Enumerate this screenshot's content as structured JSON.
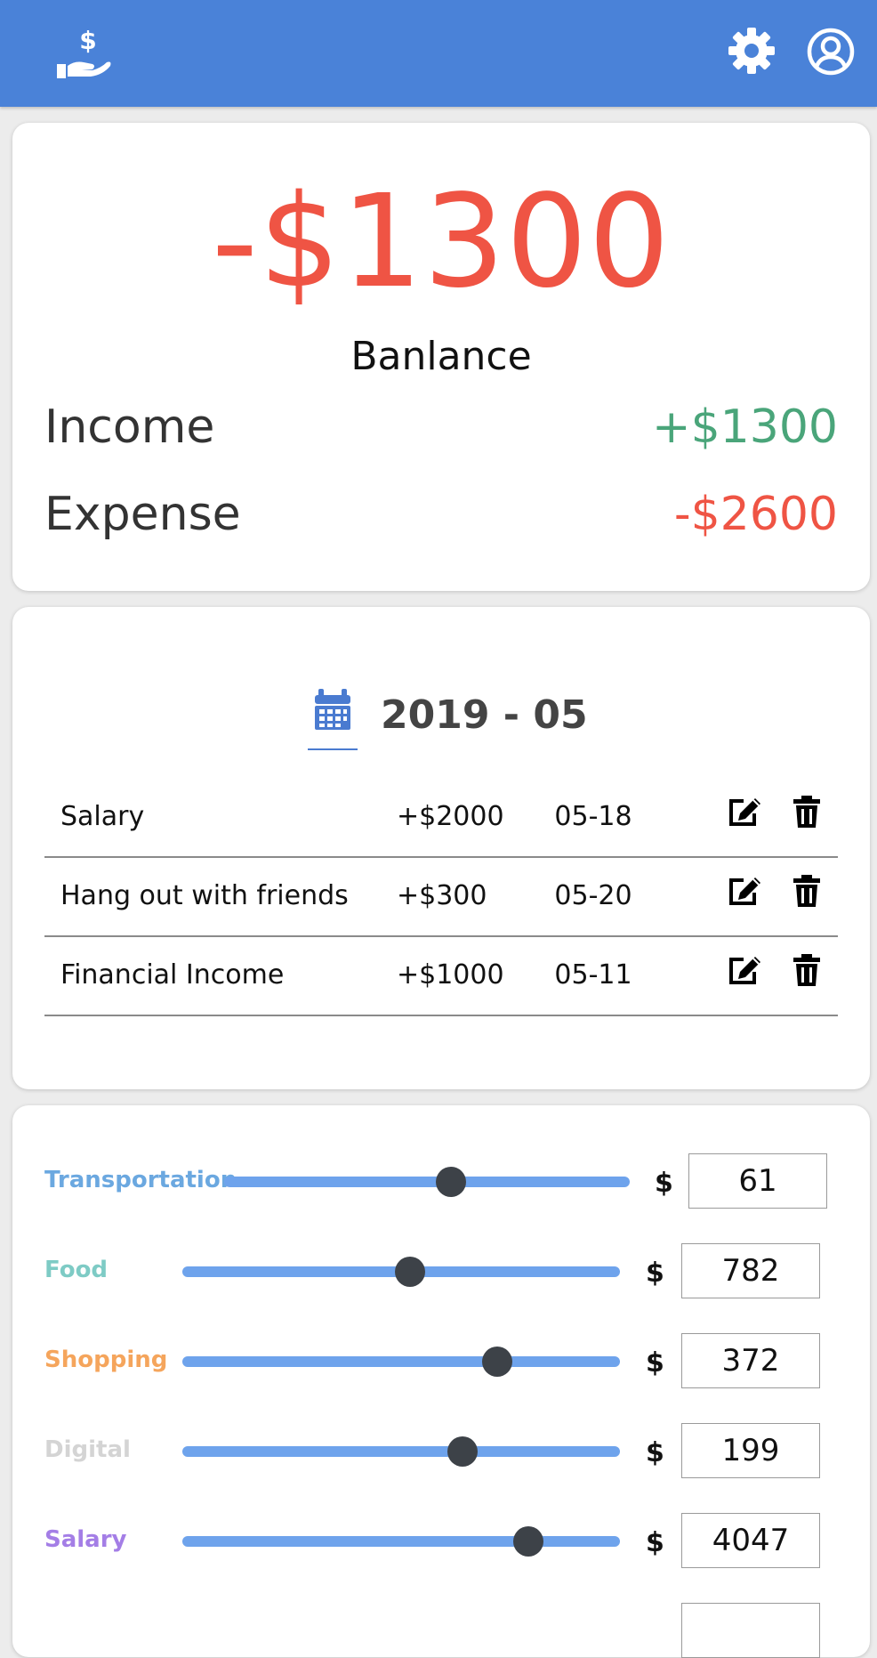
{
  "header": {
    "logo_icon": "hand-holding-dollar-icon",
    "settings_icon": "gear-icon",
    "profile_icon": "user-circle-icon",
    "bg_color": "#4a82d8"
  },
  "summary": {
    "balance": "-$1300",
    "balance_label": "Banlance",
    "income_label": "Income",
    "income_value": "+$1300",
    "expense_label": "Expense",
    "expense_value": "-$2600",
    "positive_color": "#4aa57a",
    "negative_color": "#ef5444"
  },
  "transactions": {
    "month": "2019 - 05",
    "calendar_icon": "calendar-icon",
    "items": [
      {
        "name": "Salary",
        "amount": "+$2000",
        "date": "05-18"
      },
      {
        "name": "Hang out with friends",
        "amount": "+$300",
        "date": "05-20"
      },
      {
        "name": "Financial Income",
        "amount": "+$1000",
        "date": "05-11"
      }
    ],
    "edit_icon": "edit-icon",
    "delete_icon": "trash-icon"
  },
  "categories": {
    "currency_symbol": "$",
    "items": [
      {
        "label": "Transportation",
        "color": "#6ba8e0",
        "value": "61",
        "slider": 0.56
      },
      {
        "label": "Food",
        "color": "#7ecbc5",
        "value": "782",
        "slider": 0.52
      },
      {
        "label": "Shopping",
        "color": "#f5a55c",
        "value": "372",
        "slider": 0.72
      },
      {
        "label": "Digital",
        "color": "#d4d4d4",
        "value": "199",
        "slider": 0.64
      },
      {
        "label": "Salary",
        "color": "#a47ee6",
        "value": "4047",
        "slider": 0.79
      }
    ]
  }
}
